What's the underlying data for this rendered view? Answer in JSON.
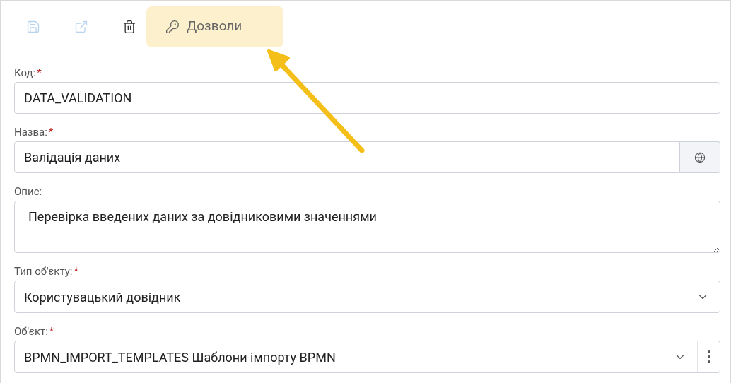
{
  "toolbar": [
    {
      "kind": "save",
      "disabled": true
    },
    {
      "kind": "export",
      "disabled": true
    },
    {
      "kind": "delete",
      "disabled": false
    },
    {
      "kind": "permissions",
      "label": "Дозволи",
      "disabled": false,
      "highlighted": true
    }
  ],
  "fields": [
    {
      "kind": "text",
      "label": "Код:",
      "required": "*",
      "value": "DATA_VALIDATION"
    },
    {
      "kind": "translatable",
      "label": "Назва:",
      "required": "*",
      "value": "Валідація даних"
    },
    {
      "kind": "textarea",
      "label": "Опис:",
      "value": "Перевірка введених даних за довідниковими значеннями"
    },
    {
      "kind": "select",
      "label": "Тип об'єкту:",
      "required": "*",
      "value": "Користувацький довідник"
    },
    {
      "kind": "select_menu",
      "label": "Об'єкт:",
      "required": "*",
      "value": "BPMN_IMPORT_TEMPLATES Шаблони імпорту BPMN"
    }
  ]
}
